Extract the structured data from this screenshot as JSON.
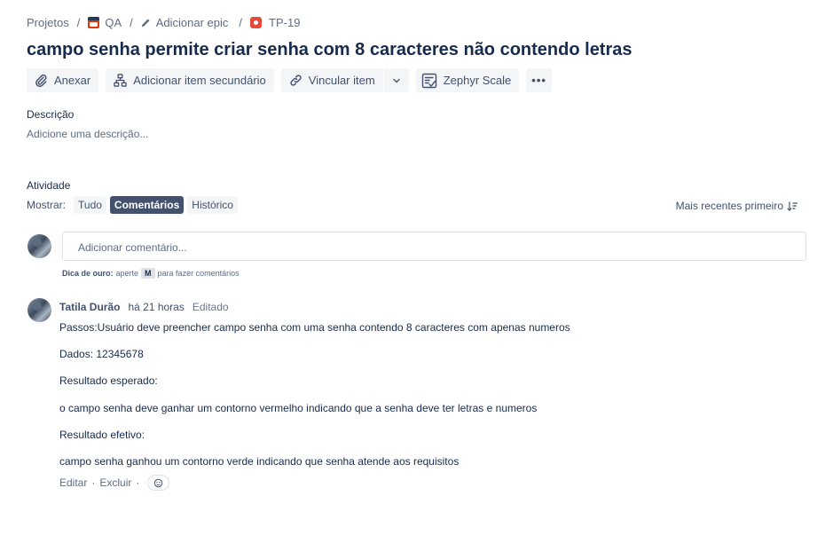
{
  "breadcrumb": {
    "projects": "Projetos",
    "project": "QA",
    "epic": "Adicionar epic",
    "issue": "TP-19",
    "separator": "/"
  },
  "issue": {
    "title": "campo senha permite criar senha com 8 caracteres não contendo letras"
  },
  "toolbar": {
    "attach": "Anexar",
    "child": "Adicionar item secundário",
    "link": "Vincular item",
    "zephyr": "Zephyr Scale",
    "more": "•••"
  },
  "description": {
    "label": "Descrição",
    "placeholder": "Adicione uma descrição..."
  },
  "activity": {
    "label": "Atividade",
    "show": "Mostrar:",
    "tabs": [
      "Tudo",
      "Comentários",
      "Histórico"
    ],
    "active_tab": "Comentários",
    "sort": "Mais recentes primeiro"
  },
  "new_comment": {
    "placeholder": "Adicionar comentário...",
    "tip_bold": "Dica de ouro:",
    "tip_pre": "aperte",
    "tip_key": "M",
    "tip_post": "para fazer comentários"
  },
  "comment": {
    "author": "Tatila Durão",
    "time": "há 21 horas",
    "edited": "Editado",
    "lines": [
      "Passos:Usuário deve preencher campo senha com uma senha contendo 8 caracteres com apenas numeros",
      "Dados: 12345678",
      "Resultado esperado:",
      "o campo senha deve ganhar um contorno vermelho indicando que a senha deve ter letras e numeros",
      "Resultado efetivo:",
      "campo senha ganhou um contorno verde indicando que senha atende aos requisitos"
    ],
    "edit": "Editar",
    "delete": "Excluir",
    "dot": "·"
  },
  "colors": {
    "text": "#172b4d",
    "subtle": "#5e6c84",
    "button_bg": "#f4f5f7",
    "active_tab_bg": "#42526e"
  }
}
